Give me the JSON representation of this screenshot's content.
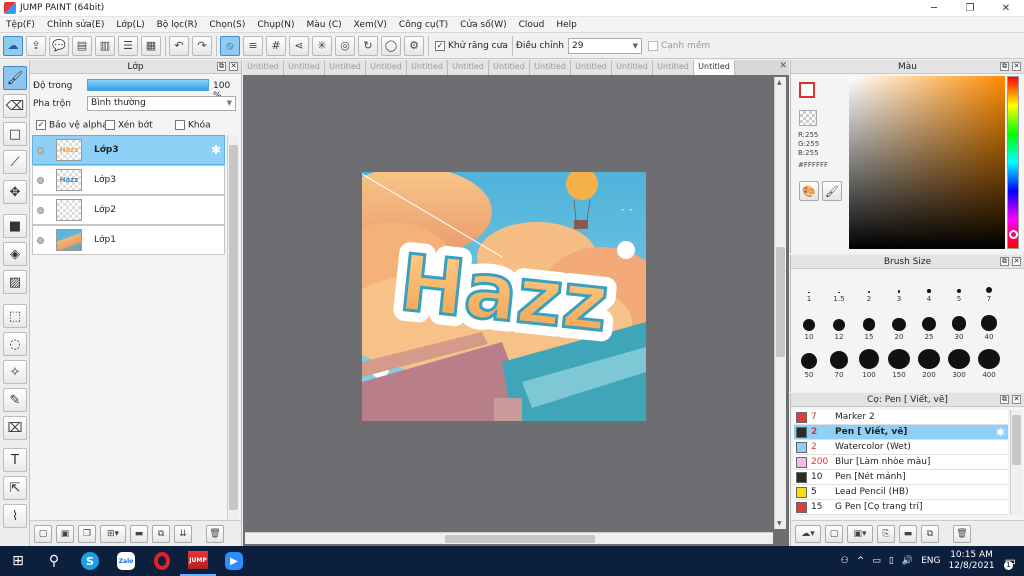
{
  "window": {
    "title": "JUMP PAINT (64bit)",
    "minimize": "─",
    "maximize": "❐",
    "close": "✕"
  },
  "menu": [
    "Tệp(F)",
    "Chỉnh sửa(E)",
    "Lớp(L)",
    "Bộ lọc(R)",
    "Chọn(S)",
    "Chụp(N)",
    "Màu (C)",
    "Xem(V)",
    "Công cụ(T)",
    "Cửa số(W)",
    "Cloud",
    "Help"
  ],
  "toolbar": {
    "antialias_label": "Khử răng cưa",
    "antialias_checked": "✓",
    "adjust_label": "Điều chỉnh",
    "adjust_value": "29",
    "edge_label": "Cạnh mềm"
  },
  "layer_panel": {
    "title": "Lớp",
    "opacity_label": "Độ trong",
    "opacity_value": "100 %",
    "blend_label": "Pha trộn",
    "blend_value": "Bình thường",
    "protect_alpha": "Bảo vệ alpha",
    "protect_alpha_checked": "✓",
    "clip": "Xén bớt",
    "lock": "Khóa",
    "layers": [
      {
        "name": "Lớp3",
        "thumb": "Hazz",
        "selected": true
      },
      {
        "name": "Lớp3",
        "thumb": "Hazz",
        "selected": false
      },
      {
        "name": "Lớp2",
        "thumb": "",
        "selected": false
      },
      {
        "name": "Lớp1",
        "thumb": "",
        "selected": false
      }
    ]
  },
  "doc_tabs": [
    "Untitled",
    "Untitled",
    "Untitled",
    "Untitled",
    "Untitled",
    "Untitled",
    "Untitled",
    "Untitled",
    "Untitled",
    "Untitled",
    "Untitled",
    "Untitled"
  ],
  "artwork": {
    "text": "Hazz"
  },
  "color_panel": {
    "title": "Màu",
    "r": "R:255",
    "g": "G:255",
    "b": "B:255",
    "hex": "#FFFFFF"
  },
  "brush_size_panel": {
    "title": "Brush Size",
    "sizes": [
      "1",
      "1.5",
      "2",
      "3",
      "4",
      "5",
      "7",
      "10",
      "12",
      "15",
      "20",
      "25",
      "30",
      "40",
      "50",
      "70",
      "100",
      "150",
      "200",
      "300",
      "400"
    ]
  },
  "pen_panel": {
    "title": "Cọ: Pen [ Viết, vẽ]",
    "items": [
      {
        "size": "7",
        "name": "Marker 2",
        "color": "#e23b3b"
      },
      {
        "size": "2",
        "name": "Pen [ Viết, vẽ]",
        "color": "#2b2b2b"
      },
      {
        "size": "2",
        "name": "Watercolor (Wet)",
        "color": "#8fd0f6"
      },
      {
        "size": "200",
        "name": "Blur [Làm nhòe màu]",
        "color": "#f8b8e8"
      },
      {
        "size": "10",
        "name": "Pen [Nét mảnh]",
        "color": "#2b2b2b"
      },
      {
        "size": "5",
        "name": "Lead Pencil (HB)",
        "color": "#f5e000"
      },
      {
        "size": "15",
        "name": "G Pen [Cọ trang trí]",
        "color": "#e23b3b"
      }
    ]
  },
  "taskbar": {
    "apps": [
      "Windows",
      "Search",
      "Skype",
      "Zalo",
      "Opera",
      "Jump Paint",
      "Zoom"
    ],
    "language": "ENG",
    "time": "10:15 AM",
    "date": "12/8/2021",
    "notifications": "1"
  },
  "colors": {
    "accent": "#8fd0f6",
    "taskbar": "#0c1f3d",
    "canvas_bg": "#6e6e72"
  }
}
